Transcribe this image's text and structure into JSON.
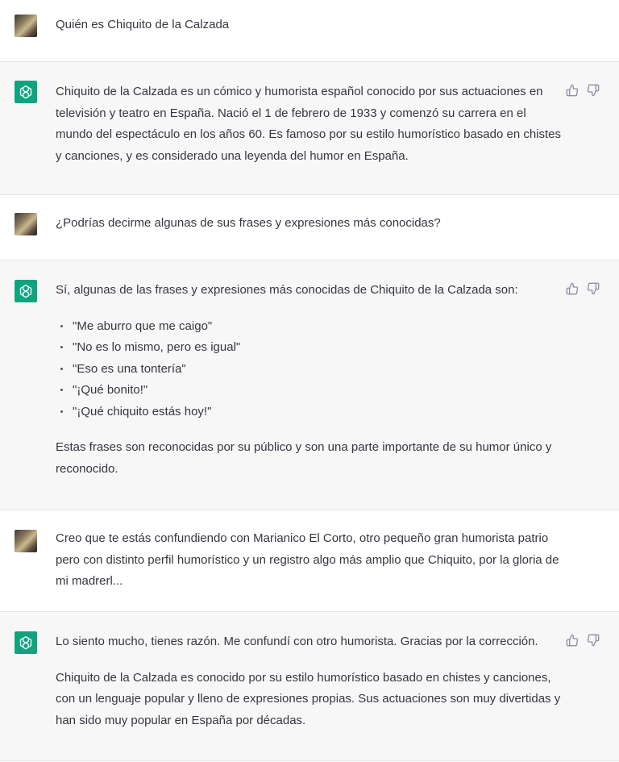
{
  "colors": {
    "bot_avatar": "#10a37f",
    "bot_bg": "#f7f7f8",
    "user_bg": "#ffffff",
    "text": "#353740"
  },
  "icons": {
    "user_avatar": "user-avatar-photo",
    "bot_avatar": "openai-logo-icon",
    "thumbs_up": "thumbs-up-icon",
    "thumbs_down": "thumbs-down-icon"
  },
  "messages": [
    {
      "role": "user",
      "text": "Quién es Chiquito de la Calzada"
    },
    {
      "role": "assistant",
      "paragraphs": [
        "Chiquito de la Calzada es un cómico y humorista español conocido por sus actuaciones en televisión y teatro en España. Nació el 1 de febrero de 1933 y comenzó su carrera en el mundo del espectáculo en los años 60. Es famoso por su estilo humorístico basado en chistes y canciones, y es considerado una leyenda del humor en España."
      ]
    },
    {
      "role": "user",
      "text": "¿Podrías decirme algunas de sus frases y expresiones más conocidas?"
    },
    {
      "role": "assistant",
      "intro": "Sí, algunas de las frases y expresiones más conocidas de Chiquito de la Calzada son:",
      "bullets": [
        "\"Me aburro que me caigo\"",
        "\"No es lo mismo, pero es igual\"",
        "\"Eso es una tontería\"",
        "\"¡Qué bonito!\"",
        "\"¡Qué chiquito estás hoy!\""
      ],
      "outro": "Estas frases son reconocidas por su público y son una parte importante de su humor único y reconocido."
    },
    {
      "role": "user",
      "text": "Creo que te estás confundiendo con Marianico El Corto, otro pequeño gran humorista patrio pero con distinto perfil humorístico y un registro algo más amplio que Chiquito, por la gloria de mi madrerl..."
    },
    {
      "role": "assistant",
      "paragraphs": [
        "Lo siento mucho, tienes razón. Me confundí con otro humorista. Gracias por la corrección.",
        "Chiquito de la Calzada es conocido por su estilo humorístico basado en chistes y canciones, con un lenguaje popular y lleno de expresiones propias. Sus actuaciones son muy divertidas y han sido muy popular en España por décadas."
      ]
    }
  ]
}
